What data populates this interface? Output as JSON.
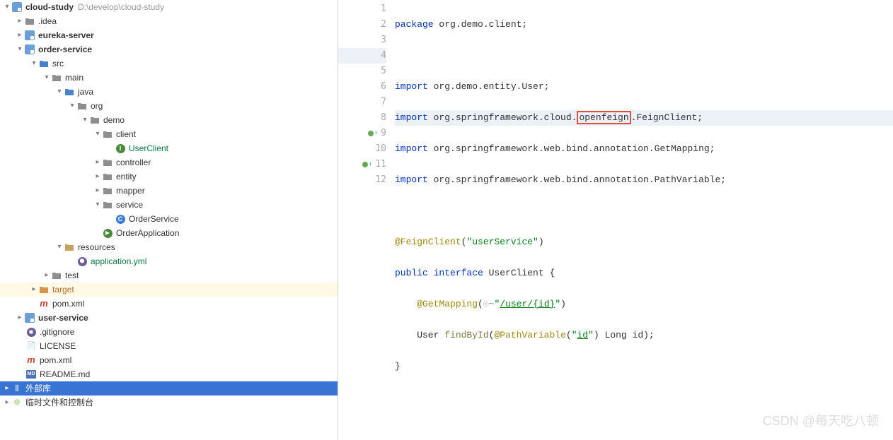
{
  "project": {
    "root_name": "cloud-study",
    "root_path": "D:\\develop\\cloud-study",
    "idea": ".idea",
    "eureka": "eureka-server",
    "order": "order-service",
    "src": "src",
    "main": "main",
    "java": "java",
    "org": "org",
    "demo": "demo",
    "client": "client",
    "userclient": "UserClient",
    "controller": "controller",
    "entity": "entity",
    "mapper": "mapper",
    "service": "service",
    "orderservice": "OrderService",
    "orderapp": "OrderApplication",
    "resources": "resources",
    "appyml": "application.yml",
    "test": "test",
    "target": "target",
    "pomxml": "pom.xml",
    "userservice": "user-service",
    "gitignore": ".gitignore",
    "license": "LICENSE",
    "pomxml2": "pom.xml",
    "readme": "README.md",
    "external": "外部库",
    "scratches": "临时文件和控制台"
  },
  "code": {
    "l1a": "package",
    "l1b": " org.demo.client;",
    "l3a": "import",
    "l3b": " org.demo.entity.User;",
    "l4a": "import",
    "l4b": " org.springframework.cloud.",
    "l4c": "openfeign",
    "l4d": ".FeignClient;",
    "l5a": "import",
    "l5b": " org.springframework.web.bind.annotation.GetMapping;",
    "l6a": "import",
    "l6b": " org.springframework.web.bind.annotation.PathVariable;",
    "l8a": "@FeignClient",
    "l8b": "(",
    "l8c": "\"userService\"",
    "l8d": ")",
    "l9a": "public interface ",
    "l9b": "UserClient",
    "l9c": " {",
    "l10a": "    ",
    "l10b": "@GetMapping",
    "l10c": "(",
    "l10d": "\"",
    "l10e": "/user/{id}",
    "l10f": "\"",
    "l10g": ")",
    "l11a": "    User ",
    "l11b": "findById",
    "l11c": "(",
    "l11d": "@PathVariable",
    "l11e": "(",
    "l11f": "\"",
    "l11g": "id",
    "l11h": "\"",
    "l11i": ") Long id);",
    "l12a": "}"
  },
  "gutter": {
    "n1": "1",
    "n2": "2",
    "n3": "3",
    "n4": "4",
    "n5": "5",
    "n6": "6",
    "n7": "7",
    "n8": "8",
    "n9": "9",
    "n10": "10",
    "n11": "11",
    "n12": "12"
  },
  "watermark": "CSDN @每天吃八顿"
}
